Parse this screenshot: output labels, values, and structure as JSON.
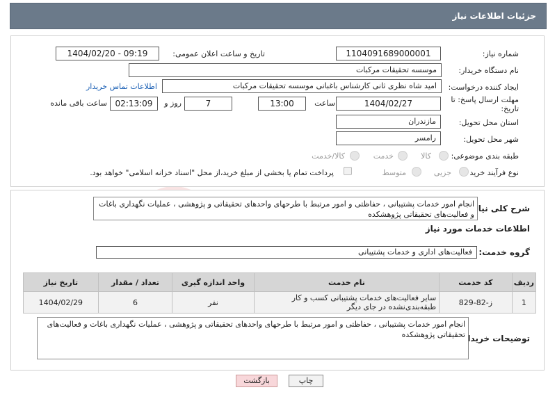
{
  "header": {
    "title": "جزئیات اطلاعات نیاز"
  },
  "fields": {
    "need_number_label": "شماره نیاز:",
    "need_number": "1104091689000001",
    "announce_label": "تاریخ و ساعت اعلان عمومی:",
    "announce_value": "1404/02/20 - 09:19",
    "buyer_org_label": "نام دستگاه خریدار:",
    "buyer_org": "موسسه تحقیقات مرکبات",
    "creator_label": "ایجاد کننده درخواست:",
    "creator": "امید شاه نظری ثانی کارشناس باغبانی موسسه تحقیقات مرکبات",
    "contact_link": "اطلاعات تماس خریدار",
    "deadline_label_1": "مهلت ارسال پاسخ: تا",
    "deadline_label_2": "تاریخ:",
    "deadline_date": "1404/02/27",
    "time_label": "ساعت",
    "deadline_time": "13:00",
    "days_value": "7",
    "days_label": "روز و",
    "remaining_time": "02:13:09",
    "remaining_label": "ساعت باقی مانده",
    "province_label": "استان محل تحویل:",
    "province": "مازندران",
    "city_label": "شهر محل تحویل:",
    "city": "رامسر",
    "category_label": "طبقه بندی موضوعی:",
    "category_options": [
      "کالا",
      "خدمت",
      "کالا/خدمت"
    ],
    "process_label": "نوع فرآیند خرید :",
    "process_options": [
      "جزیی",
      "متوسط"
    ],
    "treasury_note": "پرداخت تمام یا بخشی از مبلغ خرید،از محل \"اسناد خزانه اسلامی\" خواهد بود."
  },
  "summary": {
    "label": "شرح کلی نیاز:",
    "text": "انجام امور خدمات پشتیبانی ، حفاظتی و امور مرتبط با طرحهای واحدهای تحقیقاتی و پژوهشی ، عملیات نگهداری باغات و فعالیت‌های تحقیقاتی پژوهشکده"
  },
  "services": {
    "section_title": "اطلاعات خدمات مورد نیاز",
    "group_label": "گروه خدمت:",
    "group_value": "فعالیت‌های اداری و خدمات پشتیبانی",
    "table": {
      "headers": [
        "ردیف",
        "کد خدمت",
        "نام خدمت",
        "واحد اندازه گیری",
        "تعداد / مقدار",
        "تاریخ نیاز"
      ],
      "rows": [
        [
          "1",
          "ز-82-829",
          "سایر فعالیت‌های خدمات پشتیبانی کسب و کار طبقه‌بندی‌نشده در جای دیگر",
          "نفر",
          "6",
          "1404/02/29"
        ]
      ]
    }
  },
  "buyer_notes": {
    "label": "توضیحات خریدار:",
    "text": "انجام امور خدمات پشتیبانی ، حفاظتی و امور مرتبط با طرحهای واحدهای تحقیقاتی و پژوهشی ، عملیات نگهداری باغات و فعالیت‌های تحقیقاتی پژوهشکده"
  },
  "buttons": {
    "print": "چاپ",
    "back": "بازگشت"
  },
  "colors": {
    "header_bg": "#6b7a8a",
    "link": "#1a5fb4",
    "back_button_bg": "#f8d7da"
  }
}
